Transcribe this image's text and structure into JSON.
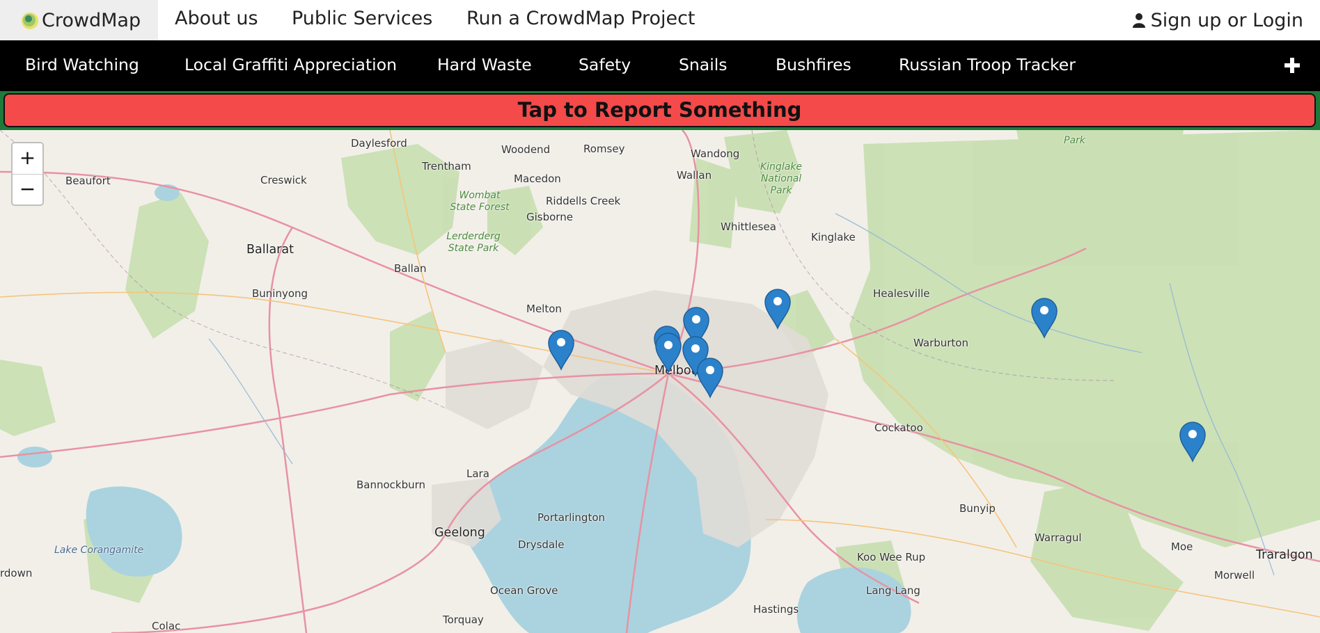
{
  "header": {
    "brand": "CrowdMap",
    "links": [
      "About us",
      "Public Services",
      "Run a CrowdMap Project"
    ],
    "login": "Sign up or Login"
  },
  "categories": [
    "Bird Watching",
    "Local Graffiti Appreciation",
    "Hard Waste",
    "Safety",
    "Snails",
    "Bushfires",
    "Russian Troop Tracker"
  ],
  "report_button": "Tap to Report Something",
  "map": {
    "zoom_in": "+",
    "zoom_out": "−",
    "places": {
      "daylesford": "Daylesford",
      "woodend": "Woodend",
      "romsey": "Romsey",
      "wandong": "Wandong",
      "trentham": "Trentham",
      "beaufort": "Beaufort",
      "creswick": "Creswick",
      "macedon": "Macedon",
      "wallan": "Wallan",
      "kinglake_np": "Kinglake National Park",
      "wombat": "Wombat State Forest",
      "riddells": "Riddells Creek",
      "gisborne": "Gisborne",
      "whittlesea": "Whittlesea",
      "kinglake": "Kinglake",
      "lerderderg": "Lerderderg State Park",
      "ballarat": "Ballarat",
      "ballan": "Ballan",
      "buninyong": "Buninyong",
      "healesville": "Healesville",
      "melton": "Melton",
      "warburton": "Warburton",
      "melbourne": "Melbourne",
      "cockatoo": "Cockatoo",
      "lara": "Lara",
      "bannockburn": "Bannockburn",
      "bunyip": "Bunyip",
      "portarlington": "Portarlington",
      "geelong": "Geelong",
      "warragul": "Warragul",
      "drysdale": "Drysdale",
      "lake_corangamite": "Lake Corangamite",
      "moe": "Moe",
      "traralgon": "Traralgon",
      "koo_wee_rup": "Koo Wee Rup",
      "morwell": "Morwell",
      "rdown": "rdown",
      "ocean_grove": "Ocean Grove",
      "lang_lang": "Lang Lang",
      "torquay": "Torquay",
      "hastings": "Hastings",
      "colac": "Colac",
      "park_top": "Park"
    }
  },
  "colors": {
    "report": "#f44a4a",
    "catbar": "#000000",
    "marker": "#2b82cb"
  }
}
